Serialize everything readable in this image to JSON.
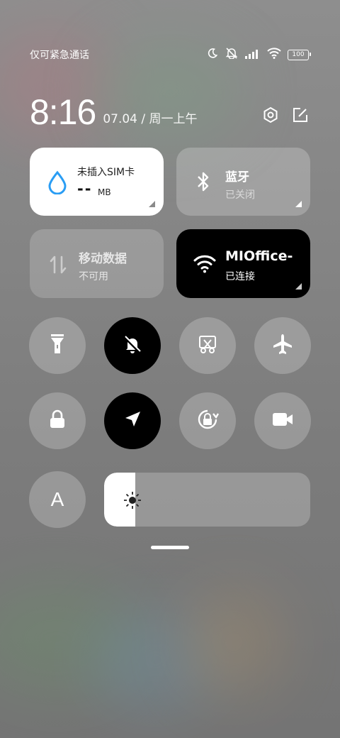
{
  "status_bar": {
    "carrier_text": "仅可紧急通话",
    "battery_level": "100"
  },
  "clock": {
    "time": "8:16",
    "date": "07.04 / 周一上午"
  },
  "tiles": {
    "data_usage": {
      "title": "未插入SIM卡",
      "value": "--",
      "unit": "MB"
    },
    "bluetooth": {
      "title": "蓝牙",
      "status": "已关闭"
    },
    "mobile_data": {
      "title": "移动数据",
      "status": "不可用"
    },
    "wifi": {
      "title": "MIOffice-",
      "status": "已连接"
    }
  },
  "toggles": [
    {
      "name": "flashlight",
      "state": "off"
    },
    {
      "name": "silent",
      "state": "on"
    },
    {
      "name": "screenshot",
      "state": "off"
    },
    {
      "name": "airplane",
      "state": "off"
    },
    {
      "name": "lock",
      "state": "off"
    },
    {
      "name": "location",
      "state": "on"
    },
    {
      "name": "auto-rotate",
      "state": "off"
    },
    {
      "name": "screen-record",
      "state": "off"
    }
  ],
  "auto_brightness_label": "A",
  "brightness": {
    "level": 0.15
  },
  "colors": {
    "active": "#000000",
    "accent_blue": "#2a9df4"
  }
}
